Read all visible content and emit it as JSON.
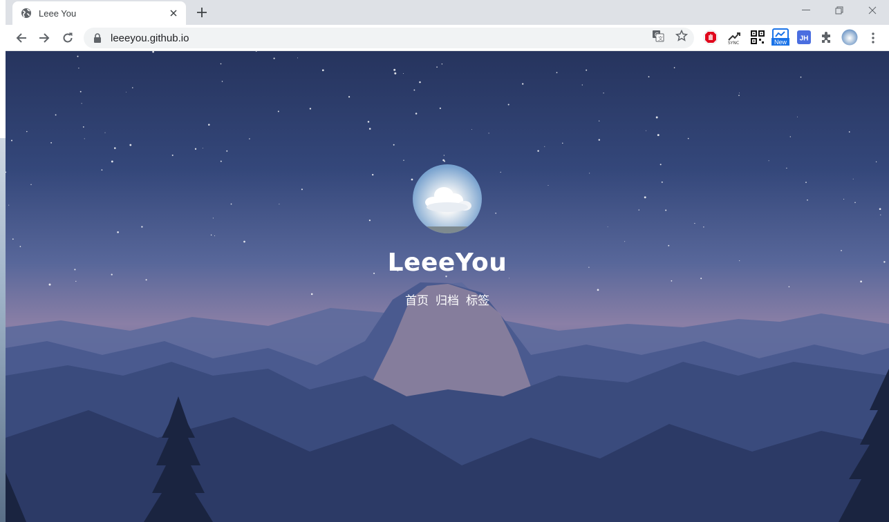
{
  "browser": {
    "tab_title": "Leee You",
    "url": "leeeyou.github.io",
    "extensions": [
      "adblock-icon",
      "cloud-sync-icon",
      "qr-code-icon",
      "new-badge-icon",
      "jh-icon",
      "puzzle-icon",
      "profile-avatar"
    ],
    "ext_new_label": "New",
    "ext_jh_label": "JH"
  },
  "page": {
    "site_title": "LeeeYou",
    "nav": [
      {
        "label": "首页"
      },
      {
        "label": "归档"
      },
      {
        "label": "标签"
      }
    ]
  },
  "colors": {
    "accent": "#1a73e8",
    "chrome_bg": "#dee1e6",
    "sky_top": "#26345e",
    "sky_horizon": "#8a7fa6"
  }
}
